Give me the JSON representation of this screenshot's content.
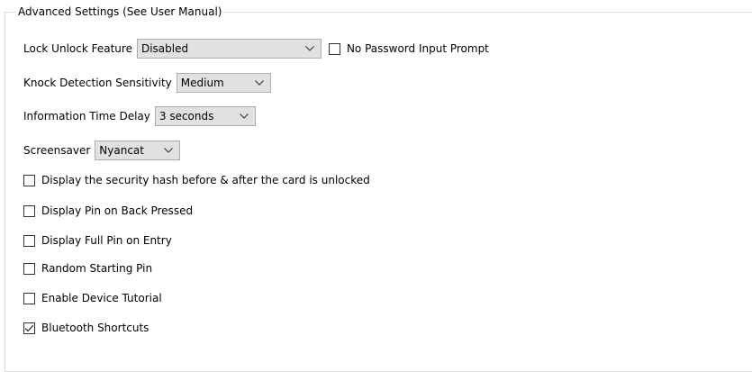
{
  "groupbox": {
    "title": "Advanced Settings (See User Manual)"
  },
  "lock_unlock": {
    "label": "Lock Unlock Feature",
    "selected": "Disabled"
  },
  "no_password_prompt": {
    "label": "No Password Input Prompt",
    "checked": false
  },
  "knock_sensitivity": {
    "label": "Knock Detection Sensitivity",
    "selected": "Medium"
  },
  "info_time_delay": {
    "label": "Information Time Delay",
    "selected": "3 seconds"
  },
  "screensaver": {
    "label": "Screensaver",
    "selected": "Nyancat"
  },
  "checkboxes": [
    {
      "label": "Display the security hash before & after the card is unlocked",
      "checked": false
    },
    {
      "label": "Display Pin on Back Pressed",
      "checked": false
    },
    {
      "label": "Display Full Pin on Entry",
      "checked": false
    },
    {
      "label": "Random Starting Pin",
      "checked": false
    },
    {
      "label": "Enable Device Tutorial",
      "checked": false
    },
    {
      "label": "Bluetooth Shortcuts",
      "checked": true
    }
  ],
  "icons": {
    "dropdown": "chevron-down-icon",
    "check": "checkmark-icon"
  },
  "colors": {
    "combo_background": "#e1e1e1",
    "combo_border": "#adadad",
    "group_border": "#dcdcdc"
  }
}
